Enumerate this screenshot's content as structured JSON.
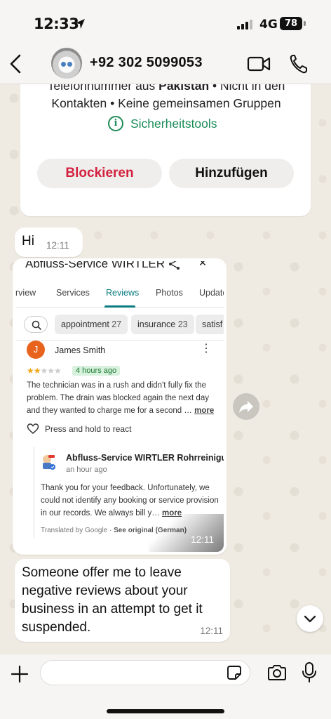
{
  "status_bar": {
    "time": "12:33",
    "network": "4G",
    "battery": "78"
  },
  "header": {
    "contact": "+92 302 5099053"
  },
  "info_card": {
    "text_pre": "Telefonnummer aus ",
    "country": "Pakistan",
    "text_post": " • Nicht in den Kontakten • Keine gemeinsamen Gruppen",
    "safety_tools": "Sicherheitstools",
    "block_label": "Blockieren",
    "add_label": "Hinzufügen"
  },
  "messages": {
    "hi": {
      "text": "Hi",
      "time": "12:11"
    },
    "image": {
      "time": "12:11"
    },
    "long": {
      "text": "Someone offer me to leave negative reviews about your business in an attempt to get it suspended.",
      "time": "12:11"
    }
  },
  "screenshot": {
    "title": "Abfluss-Service WIRTLER",
    "tabs": [
      "rview",
      "Services",
      "Reviews",
      "Photos",
      "Update"
    ],
    "active_tab": "Reviews",
    "chips": [
      {
        "label": "appointment",
        "count": "27"
      },
      {
        "label": "insurance",
        "count": "23"
      },
      {
        "label": "satisf",
        "count": ""
      }
    ],
    "review": {
      "initial": "J",
      "name": "James Smith",
      "stars_on": "★★",
      "stars_off": "★★★",
      "rating": 2,
      "badge": "4 hours ago",
      "text": "The technician was in a rush and didn't fully fix the problem. The drain was blocked again the next day and they wanted to charge me for a second …",
      "more": "more",
      "react": "Press and hold to react"
    },
    "owner": {
      "name": "Abfluss-Service WIRTLER Rohrreinigun…",
      "time": "an hour ago",
      "text": "Thank you for your feedback. Unfortunately, we could not identify any booking or service provision in our records. We always bill y…",
      "more": "more",
      "translated": "Translated by Google · ",
      "see_original": "See original (German)"
    }
  },
  "input": {
    "placeholder": ""
  },
  "colors": {
    "accent_green": "#1c8c58",
    "block_red": "#d3203f",
    "tab_teal": "#0b7c80",
    "chat_bg": "#efeae2"
  }
}
